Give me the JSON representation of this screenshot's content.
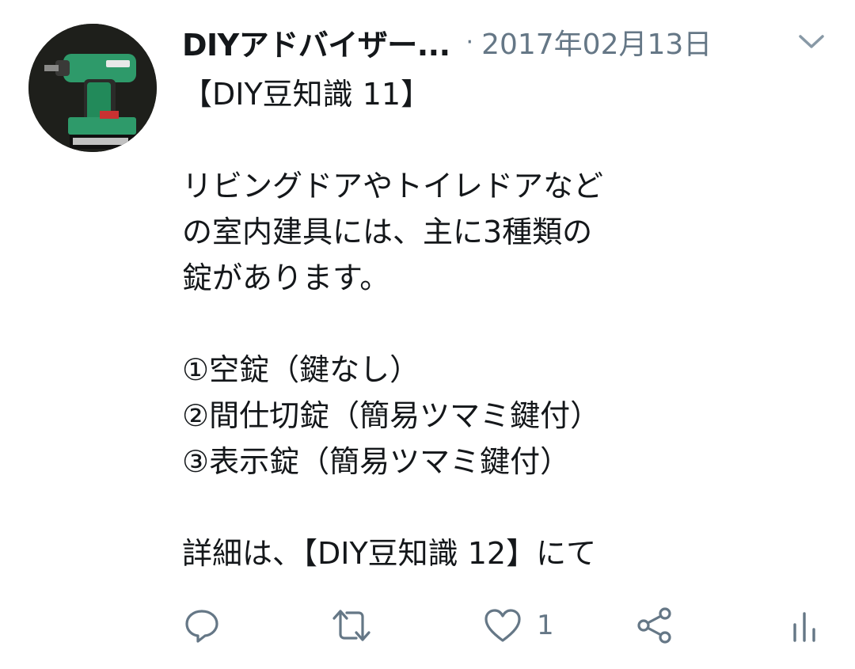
{
  "tweet": {
    "author_name": "DIYアドバイザー...",
    "separator": "·",
    "date": "2017年02月13日",
    "paragraphs": [
      "【DIY豆知識 11】",
      "",
      "リビングドアやトイレドアなど",
      "の室内建具には、主に3種類の",
      "錠があります。",
      "",
      "①空錠（鍵なし）",
      "②間仕切錠（簡易ツマミ鍵付）",
      "③表示錠（簡易ツマミ鍵付）",
      "",
      "詳細は、【DIY豆知識 12】にて"
    ]
  },
  "actions": {
    "reply_icon": "reply-icon",
    "retweet_icon": "retweet-icon",
    "like_icon": "heart-icon",
    "like_count": "1",
    "share_icon": "share-icon",
    "analytics_icon": "analytics-icon"
  },
  "colors": {
    "text": "#14171a",
    "secondary": "#657786",
    "icon": "#657786"
  }
}
